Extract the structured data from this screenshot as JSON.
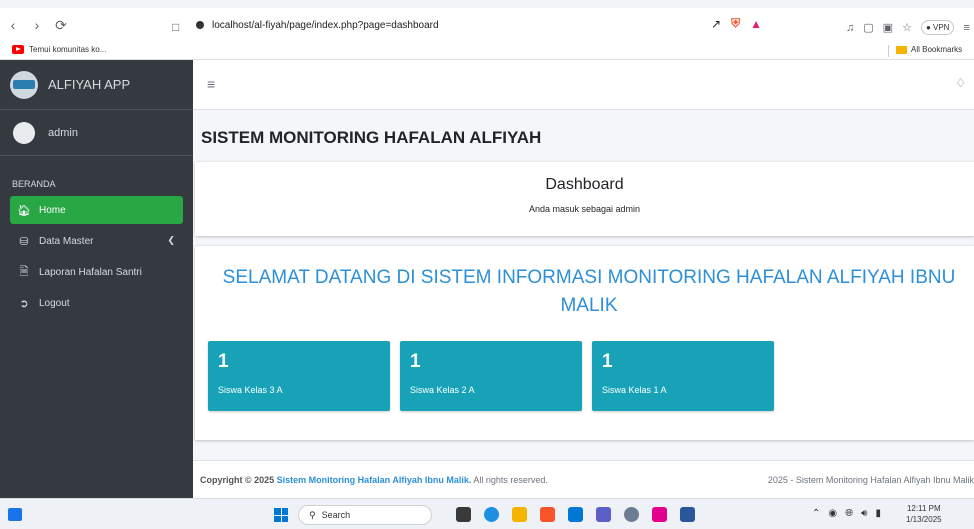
{
  "browser": {
    "url": "localhost/al-fiyah/page/index.php?page=dashboard",
    "vpn_label": "VPN",
    "bookmarks": [
      {
        "label": "Temui komunitas ko..."
      },
      {
        "label": "All Bookmarks"
      }
    ]
  },
  "sidebar": {
    "brand": "ALFIYAH APP",
    "user": "admin",
    "section_header": "BERANDA",
    "items": [
      {
        "label": "Home",
        "icon": "home-icon",
        "active": true
      },
      {
        "label": "Data Master",
        "icon": "database-icon",
        "has_submenu": true
      },
      {
        "label": "Laporan Hafalan Santri",
        "icon": "file-pdf-icon"
      },
      {
        "label": "Logout",
        "icon": "logout-icon"
      }
    ]
  },
  "header": {
    "page_title": "SISTEM MONITORING HAFALAN ALFIYAH"
  },
  "dashboard_card": {
    "title": "Dashboard",
    "subtitle": "Anda masuk sebagai admin"
  },
  "welcome": {
    "text": "SELAMAT DATANG DI SISTEM INFORMASI MONITORING HAFALAN ALFIYAH IBNU MALIK"
  },
  "stat_boxes": [
    {
      "value": "1",
      "label": "Siswa Kelas 3 A"
    },
    {
      "value": "1",
      "label": "Siswa Kelas 2 A"
    },
    {
      "value": "1",
      "label": "Siswa Kelas 1 A"
    }
  ],
  "footer": {
    "copyright_prefix": "Copyright © 2025",
    "copyright_link": "Sistem Monitoring Hafalan Alfiyah Ibnu Malik.",
    "copyright_suffix": "All rights reserved.",
    "right_text": "2025 - Sistem Monitoring Hafalan Alfiyah Ibnu Malik"
  },
  "taskbar": {
    "search_placeholder": "Search",
    "time": "12:11 PM",
    "date": "1/13/2025"
  },
  "colors": {
    "sidebar_bg": "#343a40",
    "active_green": "#28a745",
    "info_box": "#17a2b8",
    "welcome_blue": "#2b8fd9"
  }
}
